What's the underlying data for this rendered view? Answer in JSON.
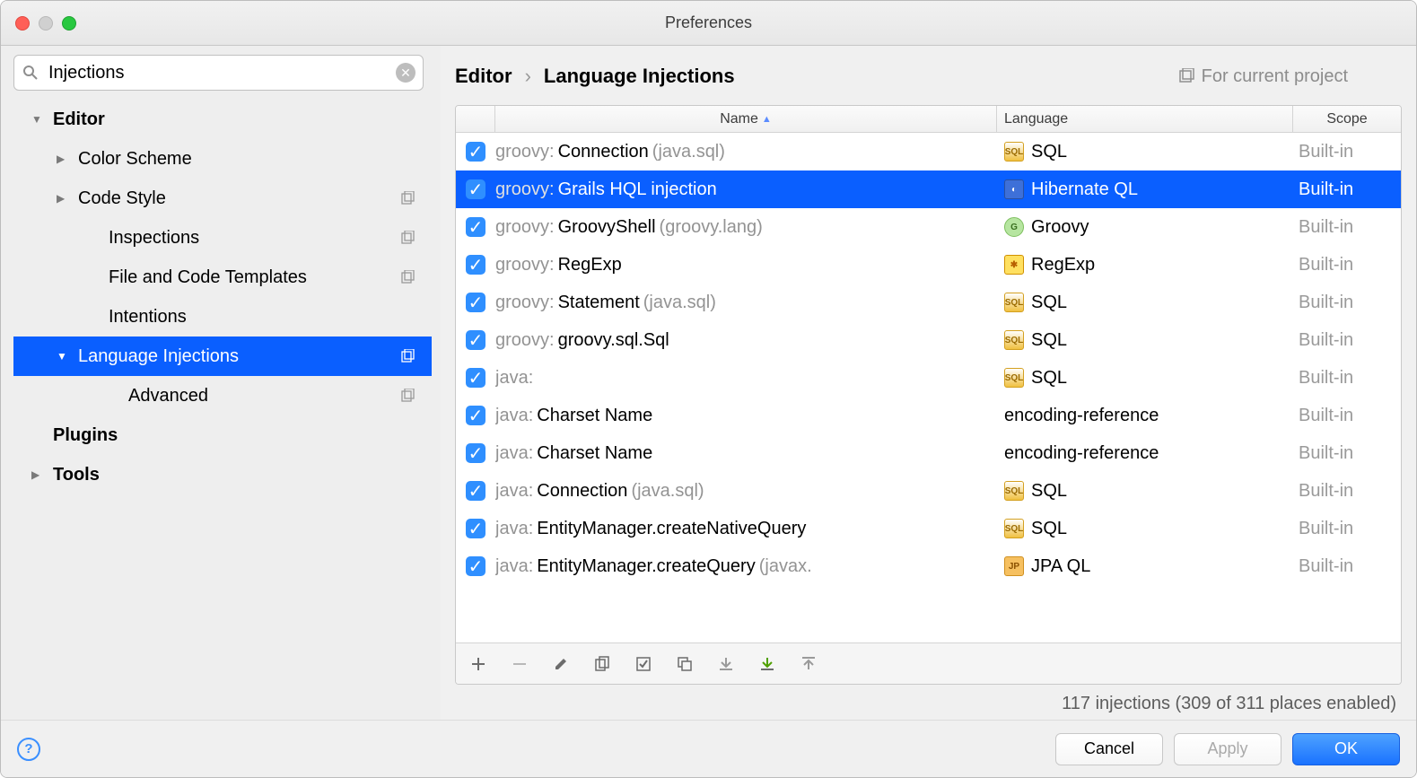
{
  "window": {
    "title": "Preferences"
  },
  "search": {
    "value": "Injections"
  },
  "tree": [
    {
      "label": "Editor",
      "level": 0,
      "bold": true,
      "arrow": "down",
      "selected": false,
      "copy": false
    },
    {
      "label": "Color Scheme",
      "level": 1,
      "bold": false,
      "arrow": "right",
      "selected": false,
      "copy": false
    },
    {
      "label": "Code Style",
      "level": 1,
      "bold": false,
      "arrow": "right",
      "selected": false,
      "copy": true
    },
    {
      "label": "Inspections",
      "level": "1nb",
      "bold": false,
      "arrow": "",
      "selected": false,
      "copy": true
    },
    {
      "label": "File and Code Templates",
      "level": "1nb",
      "bold": false,
      "arrow": "",
      "selected": false,
      "copy": true
    },
    {
      "label": "Intentions",
      "level": "1nb",
      "bold": false,
      "arrow": "",
      "selected": false,
      "copy": false
    },
    {
      "label": "Language Injections",
      "level": 1,
      "bold": false,
      "arrow": "down",
      "selected": true,
      "copy": true
    },
    {
      "label": "Advanced",
      "level": 2,
      "bold": false,
      "arrow": "",
      "selected": false,
      "copy": true
    },
    {
      "label": "Plugins",
      "level": 0,
      "bold": true,
      "arrow": "",
      "selected": false,
      "copy": false
    },
    {
      "label": "Tools",
      "level": 0,
      "bold": true,
      "arrow": "right",
      "selected": false,
      "copy": false
    }
  ],
  "breadcrumb": {
    "a": "Editor",
    "b": "Language Injections"
  },
  "project_info": "For current project",
  "columns": {
    "check": "",
    "name": "Name",
    "lang": "Language",
    "scope": "Scope"
  },
  "rows": [
    {
      "checked": true,
      "prefix": "groovy:",
      "label": "Connection",
      "suffix": "(java.sql)",
      "lang": "SQL",
      "icon": "sql",
      "scope": "Built-in",
      "selected": false
    },
    {
      "checked": true,
      "prefix": "groovy:",
      "label": "Grails HQL injection",
      "suffix": "",
      "lang": "Hibernate QL",
      "icon": "hql",
      "scope": "Built-in",
      "selected": true
    },
    {
      "checked": true,
      "prefix": "groovy:",
      "label": "GroovyShell",
      "suffix": "(groovy.lang)",
      "lang": "Groovy",
      "icon": "groovy",
      "scope": "Built-in",
      "selected": false
    },
    {
      "checked": true,
      "prefix": "groovy:",
      "label": "RegExp",
      "suffix": "",
      "lang": "RegExp",
      "icon": "regex",
      "scope": "Built-in",
      "selected": false
    },
    {
      "checked": true,
      "prefix": "groovy:",
      "label": "Statement",
      "suffix": "(java.sql)",
      "lang": "SQL",
      "icon": "sql",
      "scope": "Built-in",
      "selected": false
    },
    {
      "checked": true,
      "prefix": "groovy:",
      "label": "groovy.sql.Sql",
      "suffix": "",
      "lang": "SQL",
      "icon": "sql",
      "scope": "Built-in",
      "selected": false
    },
    {
      "checked": true,
      "prefix": "java:",
      "label": "",
      "suffix": "",
      "lang": "SQL",
      "icon": "sql",
      "scope": "Built-in",
      "selected": false
    },
    {
      "checked": true,
      "prefix": "java:",
      "label": "Charset Name",
      "suffix": "",
      "lang": "encoding-reference",
      "icon": "none",
      "scope": "Built-in",
      "selected": false
    },
    {
      "checked": true,
      "prefix": "java:",
      "label": "Charset Name",
      "suffix": "",
      "lang": "encoding-reference",
      "icon": "none",
      "scope": "Built-in",
      "selected": false
    },
    {
      "checked": true,
      "prefix": "java:",
      "label": "Connection",
      "suffix": "(java.sql)",
      "lang": "SQL",
      "icon": "sql",
      "scope": "Built-in",
      "selected": false
    },
    {
      "checked": true,
      "prefix": "java:",
      "label": "EntityManager.createNativeQuery",
      "suffix": "",
      "lang": "SQL",
      "icon": "sql",
      "scope": "Built-in",
      "selected": false
    },
    {
      "checked": true,
      "prefix": "java:",
      "label": "EntityManager.createQuery",
      "suffix": "(javax.",
      "lang": "JPA QL",
      "icon": "jpa",
      "scope": "Built-in",
      "selected": false
    }
  ],
  "status": "117 injections (309 of 311 places enabled)",
  "buttons": {
    "cancel": "Cancel",
    "apply": "Apply",
    "ok": "OK"
  }
}
